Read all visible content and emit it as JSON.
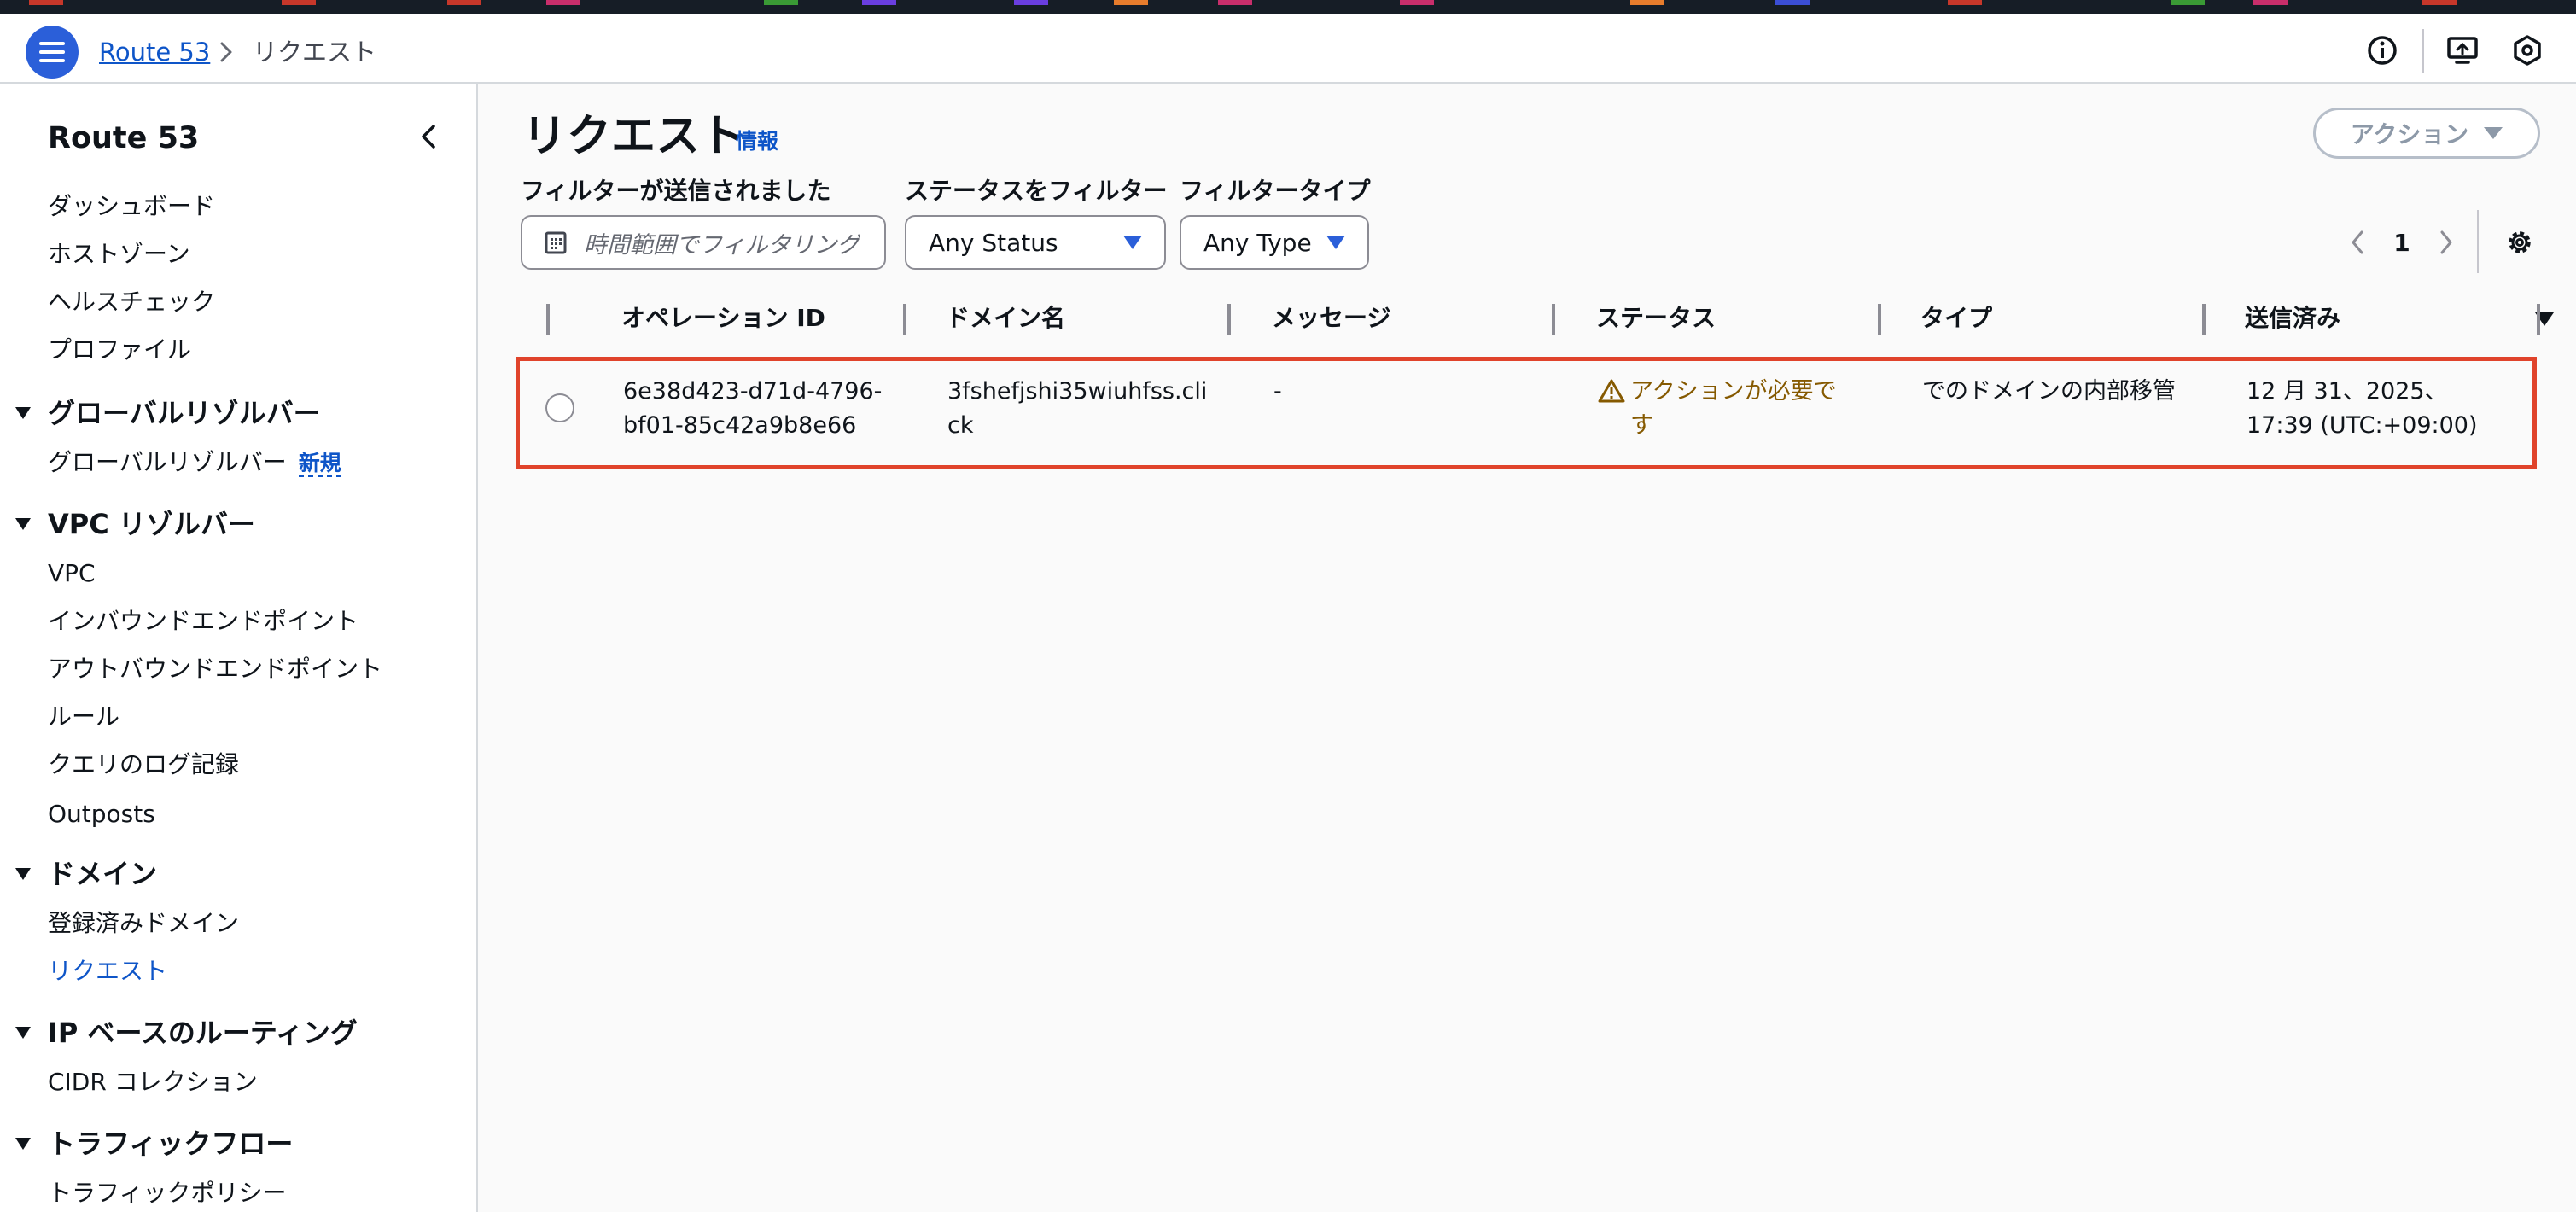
{
  "header": {
    "breadcrumb_root": "Route 53",
    "breadcrumb_current": "リクエスト"
  },
  "sidebar": {
    "title": "Route 53",
    "items": [
      {
        "label": "ダッシュボード"
      },
      {
        "label": "ホストゾーン"
      },
      {
        "label": "ヘルスチェック"
      },
      {
        "label": "プロファイル"
      }
    ],
    "sections": [
      {
        "title": "グローバルリゾルバー",
        "items": [
          {
            "label": "グローバルリゾルバー",
            "badge": "新規"
          }
        ]
      },
      {
        "title": "VPC リゾルバー",
        "items": [
          {
            "label": "VPC"
          },
          {
            "label": "インバウンドエンドポイント"
          },
          {
            "label": "アウトバウンドエンドポイント"
          },
          {
            "label": "ルール"
          },
          {
            "label": "クエリのログ記録"
          },
          {
            "label": "Outposts"
          }
        ]
      },
      {
        "title": "ドメイン",
        "items": [
          {
            "label": "登録済みドメイン"
          },
          {
            "label": "リクエスト",
            "active": true
          }
        ]
      },
      {
        "title": "IP ベースのルーティング",
        "items": [
          {
            "label": "CIDR コレクション"
          }
        ]
      },
      {
        "title": "トラフィックフロー",
        "items": [
          {
            "label": "トラフィックポリシー"
          }
        ]
      }
    ]
  },
  "main": {
    "title": "リクエスト",
    "info_link": "情報",
    "action_button": "アクション",
    "filters": {
      "date_label": "フィルターが送信されました",
      "date_placeholder": "時間範囲でフィルタリング",
      "status_label": "ステータスをフィルター",
      "status_value": "Any Status",
      "type_label": "フィルタータイプ",
      "type_value": "Any Type"
    },
    "pagination": {
      "current_page": "1"
    },
    "table": {
      "columns": [
        "オペレーション ID",
        "ドメイン名",
        "メッセージ",
        "ステータス",
        "タイプ",
        "送信済み"
      ],
      "rows": [
        {
          "operation_id": "6e38d423-d71d-4796-bf01-85c42a9b8e66",
          "domain": "3fshefjshi35wiuhfss.click",
          "message": "-",
          "status": "アクションが必要です",
          "type": "でのドメインの内部移管",
          "submitted": "12 月 31、2025、17:39 (UTC:+09:00)"
        }
      ]
    }
  },
  "colors": {
    "accent": "#0e55c8",
    "menu_button": "#2b5fd9",
    "warning": "#855900",
    "row_highlight": "#e0432b"
  },
  "icons": [
    "menu-icon",
    "chevron-right-icon",
    "info-icon",
    "screen-share-icon",
    "hexagon-settings-icon",
    "chevron-left-icon",
    "calendar-icon",
    "caret-down-icon",
    "gear-icon",
    "warning-icon"
  ]
}
